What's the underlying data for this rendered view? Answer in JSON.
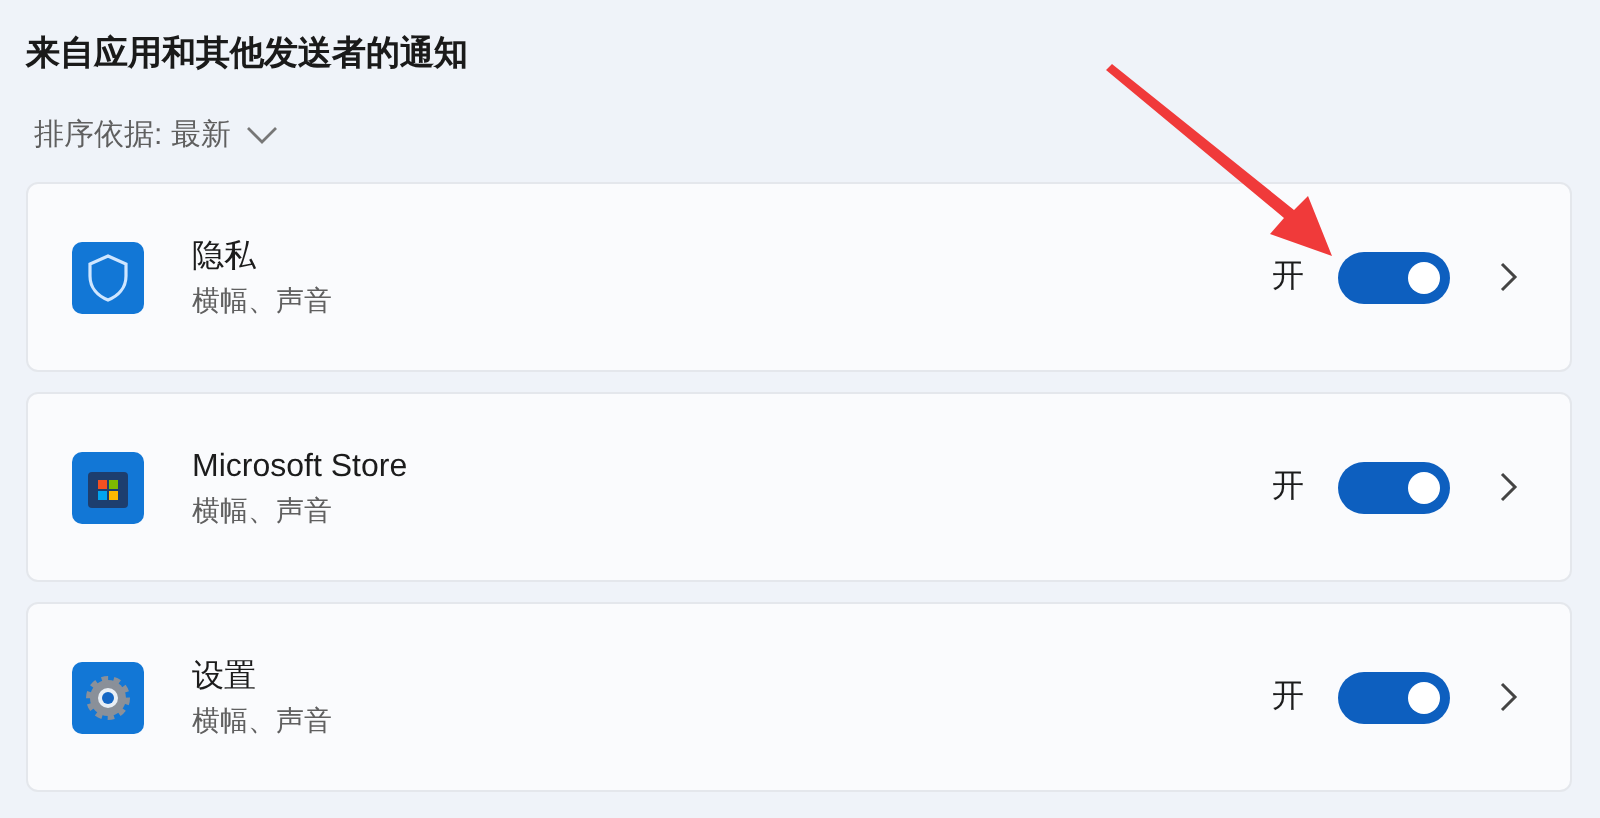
{
  "section_title": "来自应用和其他发送者的通知",
  "sort": {
    "label": "排序依据: 最新"
  },
  "apps": [
    {
      "kind": "shield",
      "name": "隐私",
      "detail": "横幅、声音",
      "toggle_label": "开",
      "on": true
    },
    {
      "kind": "store",
      "name": "Microsoft Store",
      "detail": "横幅、声音",
      "toggle_label": "开",
      "on": true
    },
    {
      "kind": "gear",
      "name": "设置",
      "detail": "横幅、声音",
      "toggle_label": "开",
      "on": true
    }
  ]
}
